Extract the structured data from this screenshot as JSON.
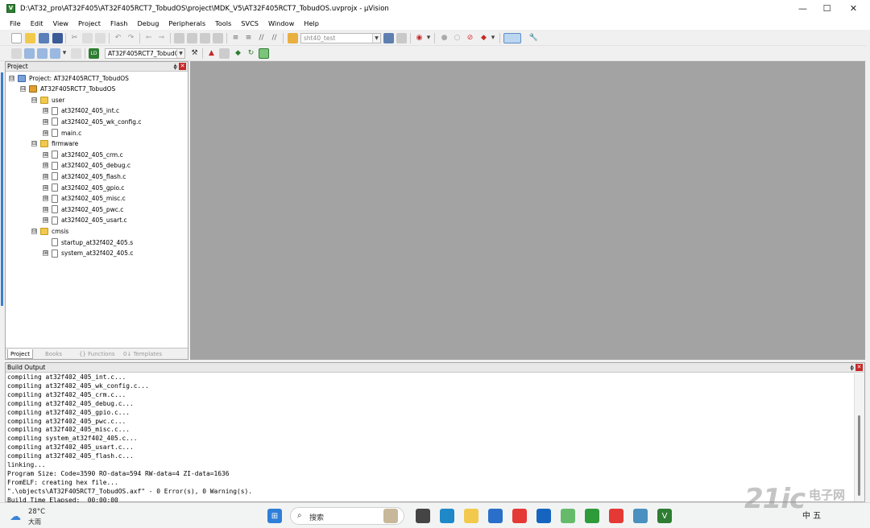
{
  "window": {
    "title": "D:\\AT32_pro\\AT32F405\\AT32F405RCT7_TobudOS\\project\\MDK_V5\\AT32F405RCT7_TobudOS.uvprojx - µVision",
    "app_glyph": "V"
  },
  "menu": [
    "File",
    "Edit",
    "View",
    "Project",
    "Flash",
    "Debug",
    "Peripherals",
    "Tools",
    "SVCS",
    "Window",
    "Help"
  ],
  "toolbar": {
    "find_combo": "sht40_test",
    "target_combo": "AT32F405RCT7_TobudOS"
  },
  "project_panel": {
    "title": "Project",
    "tree": [
      {
        "label": "Project: AT32F405RCT7_TobudOS",
        "type": "proj",
        "exp": "⊟"
      },
      {
        "label": "AT32F405RCT7_TobudOS",
        "type": "target",
        "exp": "⊟"
      },
      {
        "label": "user",
        "type": "folder",
        "exp": "⊟"
      },
      {
        "label": "at32f402_405_int.c",
        "type": "file",
        "exp": "⊞"
      },
      {
        "label": "at32f402_405_wk_config.c",
        "type": "file",
        "exp": "⊞"
      },
      {
        "label": "main.c",
        "type": "file",
        "exp": "⊞"
      },
      {
        "label": "firmware",
        "type": "folder",
        "exp": "⊟"
      },
      {
        "label": "at32f402_405_crm.c",
        "type": "file",
        "exp": "⊞"
      },
      {
        "label": "at32f402_405_debug.c",
        "type": "file",
        "exp": "⊞"
      },
      {
        "label": "at32f402_405_flash.c",
        "type": "file",
        "exp": "⊞"
      },
      {
        "label": "at32f402_405_gpio.c",
        "type": "file",
        "exp": "⊞"
      },
      {
        "label": "at32f402_405_misc.c",
        "type": "file",
        "exp": "⊞"
      },
      {
        "label": "at32f402_405_pwc.c",
        "type": "file",
        "exp": "⊞"
      },
      {
        "label": "at32f402_405_usart.c",
        "type": "file",
        "exp": "⊞"
      },
      {
        "label": "cmsis",
        "type": "folder",
        "exp": "⊟"
      },
      {
        "label": "startup_at32f402_405.s",
        "type": "file",
        "exp": ""
      },
      {
        "label": "system_at32f402_405.c",
        "type": "file",
        "exp": "⊞"
      }
    ],
    "tabs": [
      "Project",
      "Books",
      "{} Functions",
      "0↓ Templates"
    ]
  },
  "build_output": {
    "title": "Build Output",
    "lines": [
      "compiling at32f402_405_int.c...",
      "compiling at32f402_405_wk_config.c...",
      "compiling at32f402_405_crm.c...",
      "compiling at32f402_405_debug.c...",
      "compiling at32f402_405_gpio.c...",
      "compiling at32f402_405_pwc.c...",
      "compiling at32f402_405_misc.c...",
      "compiling system_at32f402_405.c...",
      "compiling at32f402_405_usart.c...",
      "compiling at32f402_405_flash.c...",
      "linking...",
      "Program Size: Code=3590 RO-data=594 RW-data=4 ZI-data=1636",
      "FromELF: creating hex file...",
      "\".\\objects\\AT32F405RCT7_TobudOS.axf\" - 0 Error(s), 0 Warning(s).",
      "Build Time Elapsed:  00:00:00"
    ]
  },
  "taskbar": {
    "temp": "28°C",
    "weather": "大雨",
    "search": "搜索",
    "tray": "中  五"
  },
  "watermark": {
    "main": "21ic",
    "sub": "电子网"
  }
}
